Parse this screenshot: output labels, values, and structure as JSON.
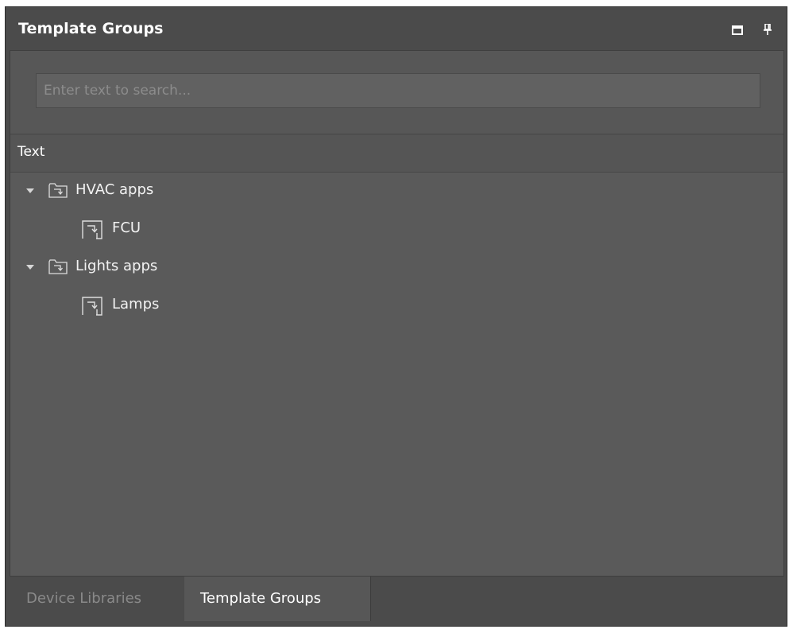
{
  "panel": {
    "title": "Template Groups",
    "maximize_icon": "maximize-icon",
    "pin_icon": "pin-icon"
  },
  "search": {
    "value": "",
    "placeholder": "Enter text to search..."
  },
  "tree": {
    "column_header": "Text",
    "groups": [
      {
        "label": "HVAC apps",
        "expanded": true,
        "icon": "template-group-folder-icon",
        "children": [
          {
            "label": "FCU",
            "icon": "template-icon"
          }
        ]
      },
      {
        "label": "Lights apps",
        "expanded": true,
        "icon": "template-group-folder-icon",
        "children": [
          {
            "label": "Lamps",
            "icon": "template-icon"
          }
        ]
      }
    ]
  },
  "tabs": [
    {
      "label": "Device Libraries",
      "active": false
    },
    {
      "label": "Template Groups",
      "active": true
    }
  ],
  "colors": {
    "panel_bg": "#4b4b4b",
    "content_bg": "#5a5a5a",
    "text": "#ffffff",
    "inactive_tab_text": "#8a8a8a"
  }
}
